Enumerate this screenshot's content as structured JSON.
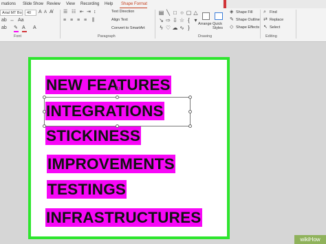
{
  "tabs": [
    {
      "label": "mations"
    },
    {
      "label": "Slide Show"
    },
    {
      "label": "Review"
    },
    {
      "label": "View"
    },
    {
      "label": "Recording"
    },
    {
      "label": "Help"
    },
    {
      "label": "Shape Format"
    }
  ],
  "active_tab": "Shape Format",
  "colors": {
    "highlight": "#f707f7",
    "slide_border": "#2ee52e",
    "accent": "#c43e1c",
    "watermark": "#8fb25b"
  },
  "font": {
    "name": "Arial MT Bold",
    "size": "40",
    "group_label": "Font"
  },
  "paragraph": {
    "group_label": "Paragraph",
    "text_direction_label": "Text Direction",
    "align_text_label": "Align Text",
    "smartart_label": "Convert to SmartArt"
  },
  "drawing": {
    "group_label": "Drawing",
    "arrange_label": "Arrange",
    "quick_styles_label": "Quick Styles",
    "shape_fill_label": "Shape Fill",
    "shape_outline_label": "Shape Outline",
    "shape_effects_label": "Shape Effects"
  },
  "editing": {
    "group_label": "Editing",
    "find_label": "Find",
    "replace_label": "Replace",
    "select_label": "Select"
  },
  "slide": {
    "lines": [
      "NEW FEATURES",
      "INTEGRATIONS",
      "STICKINESS",
      "IMPROVEMENTS",
      "TESTINGS",
      "INFRASTRUCTURES"
    ],
    "selected_line_index": 1
  },
  "watermark": "wikiHow"
}
